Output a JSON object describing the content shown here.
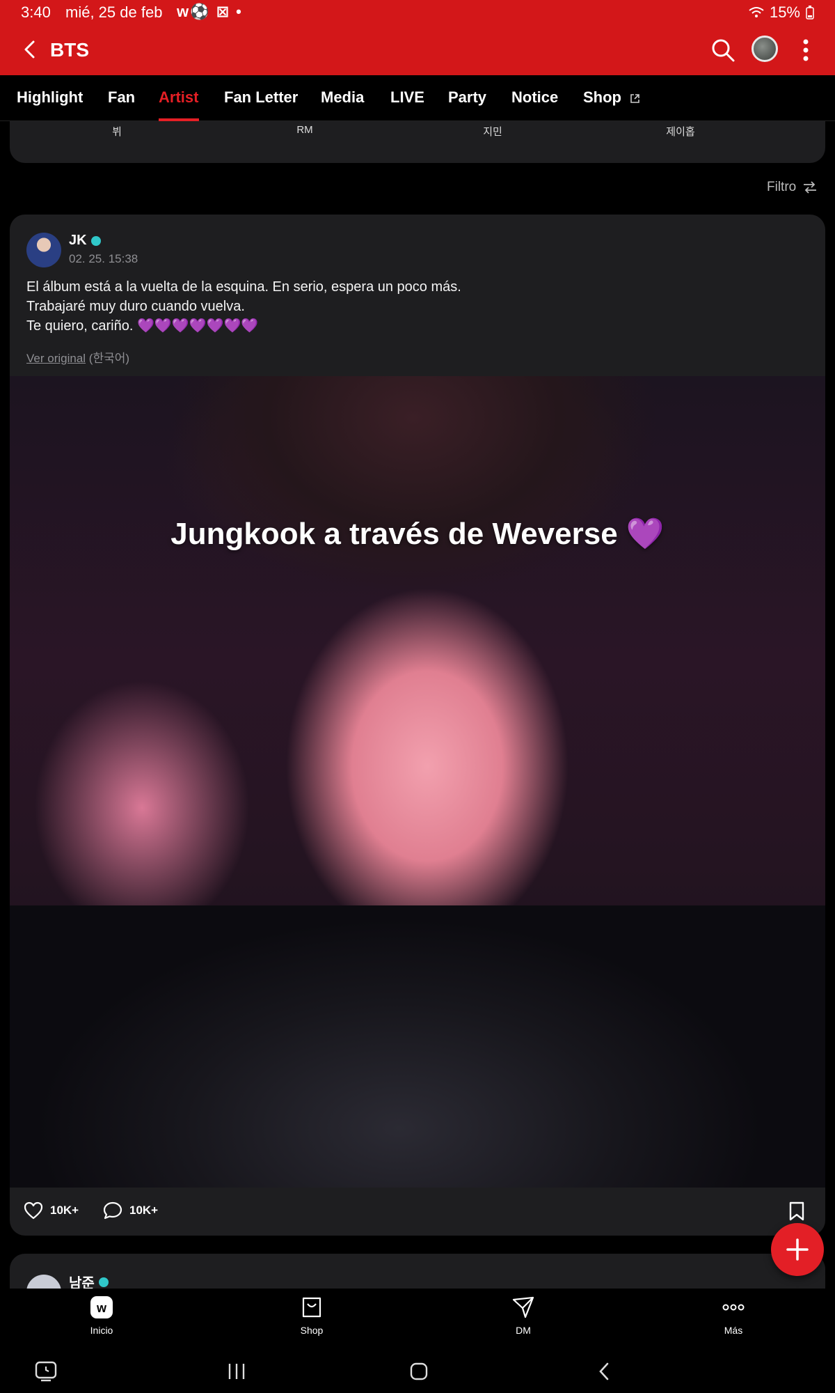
{
  "status_bar": {
    "time": "3:40",
    "date": "mié, 25 de feb",
    "notification_icons": "w⚽ ⊠ •",
    "battery": "15%"
  },
  "header": {
    "title": "BTS"
  },
  "tabs": [
    {
      "label": "Highlight"
    },
    {
      "label": "Fan"
    },
    {
      "label": "Artist",
      "active": true
    },
    {
      "label": "Fan Letter"
    },
    {
      "label": "Media"
    },
    {
      "label": "LIVE"
    },
    {
      "label": "Party"
    },
    {
      "label": "Notice"
    },
    {
      "label": "Shop"
    }
  ],
  "members": [
    "뷔",
    "RM",
    "지민",
    "제이홉"
  ],
  "filter_label": "Filtro",
  "post": {
    "author": "JK",
    "timestamp": "02. 25. 15:38",
    "body_lines": [
      "El álbum está a la vuelta de la esquina. En serio, espera un poco más.",
      "Trabajaré muy duro cuando vuelva.",
      "Te quiero, cariño. 💜💜💜💜💜💜💜"
    ],
    "translate_link": "Ver original",
    "translate_lang": "(한국어)",
    "image_caption": "Jungkook a través de Weverse 💜",
    "likes": "10K+",
    "comments": "10K+"
  },
  "next_post": {
    "author": "남준"
  },
  "bottom_nav": [
    {
      "label": "Inicio"
    },
    {
      "label": "Shop"
    },
    {
      "label": "DM"
    },
    {
      "label": "Más"
    }
  ],
  "colors": {
    "brand_red": "#d31719",
    "active_tab": "#e51f25",
    "card_bg": "#1e1e20",
    "verified": "#30c7c9"
  }
}
